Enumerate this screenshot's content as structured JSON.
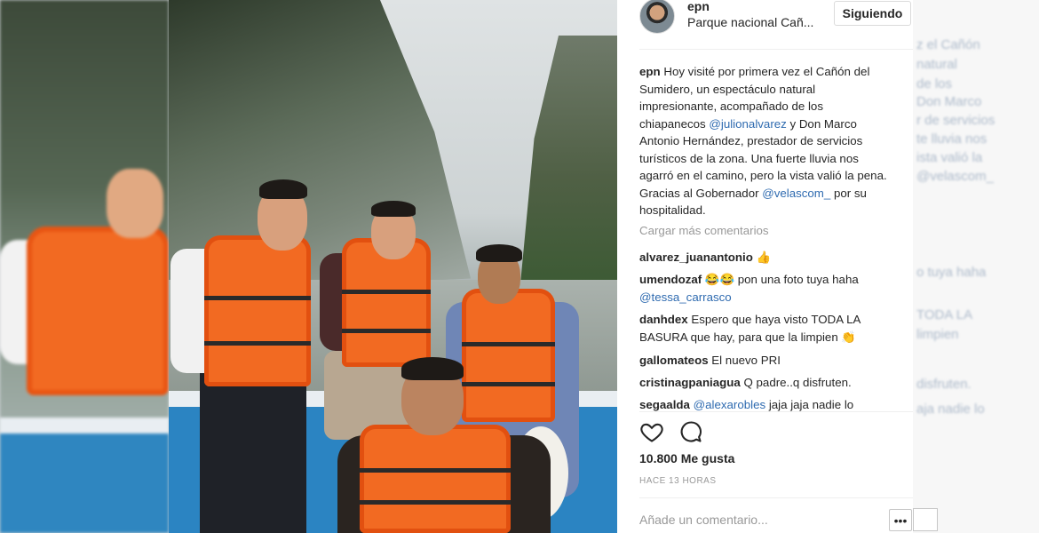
{
  "header": {
    "username": "epn",
    "location": "Parque nacional Cañ...",
    "follow_label": "Siguiendo"
  },
  "caption": {
    "username": "epn",
    "text_1": " Hoy visité por primera vez el Cañón del Sumidero, un espectáculo natural impresionante, acompañado de los chiapanecos ",
    "mention_1": "@julionalvarez",
    "text_2": " y Don Marco Antonio Hernández, prestador de servicios turísticos de la zona. Una fuerte lluvia nos agarró en el camino, pero la vista valió la pena. Gracias al Gobernador ",
    "mention_2": "@velascom_",
    "text_3": " por su hospitalidad."
  },
  "load_more": "Cargar más comentarios",
  "comments": [
    {
      "user": "alvarez_juanantonio",
      "text": " 👍"
    },
    {
      "user": "umendozaf",
      "text": " 😂😂 pon una foto tuya haha"
    },
    {
      "user": "",
      "text": "",
      "mention": "@tessa_carrasco"
    },
    {
      "user": "danhdex",
      "text": " Espero que haya visto TODA LA"
    },
    {
      "user": "",
      "text": "BASURA que hay, para que la limpien 👏"
    },
    {
      "user": "gallomateos",
      "text": " El nuevo PRI"
    },
    {
      "user": "cristinagpaniagua",
      "text": " Q padre..q disfruten."
    },
    {
      "user": "segaalda",
      "text": " jaja jaja nadie lo",
      "mention": " @alexarobles"
    }
  ],
  "actions": {
    "heart_icon": "heart-outline-icon",
    "comment_icon": "speech-bubble-icon"
  },
  "likes": "10.800 Me gusta",
  "timestamp": "HACE 13 HORAS",
  "add_comment_placeholder": "Añade un comentario...",
  "more_label": "•••",
  "ghost_text": [
    "z el Cañón",
    "natural",
    "de los",
    "Don Marco",
    "r de servicios",
    "te lluvia nos",
    "ista valió la",
    "@velascom_",
    "o tuya haha",
    "TODA LA",
    "limpien",
    "disfruten.",
    "aja nadie lo"
  ],
  "colors": {
    "link": "#2f6bb0",
    "vest": "#f26a22",
    "boat": "#2b84c2"
  }
}
